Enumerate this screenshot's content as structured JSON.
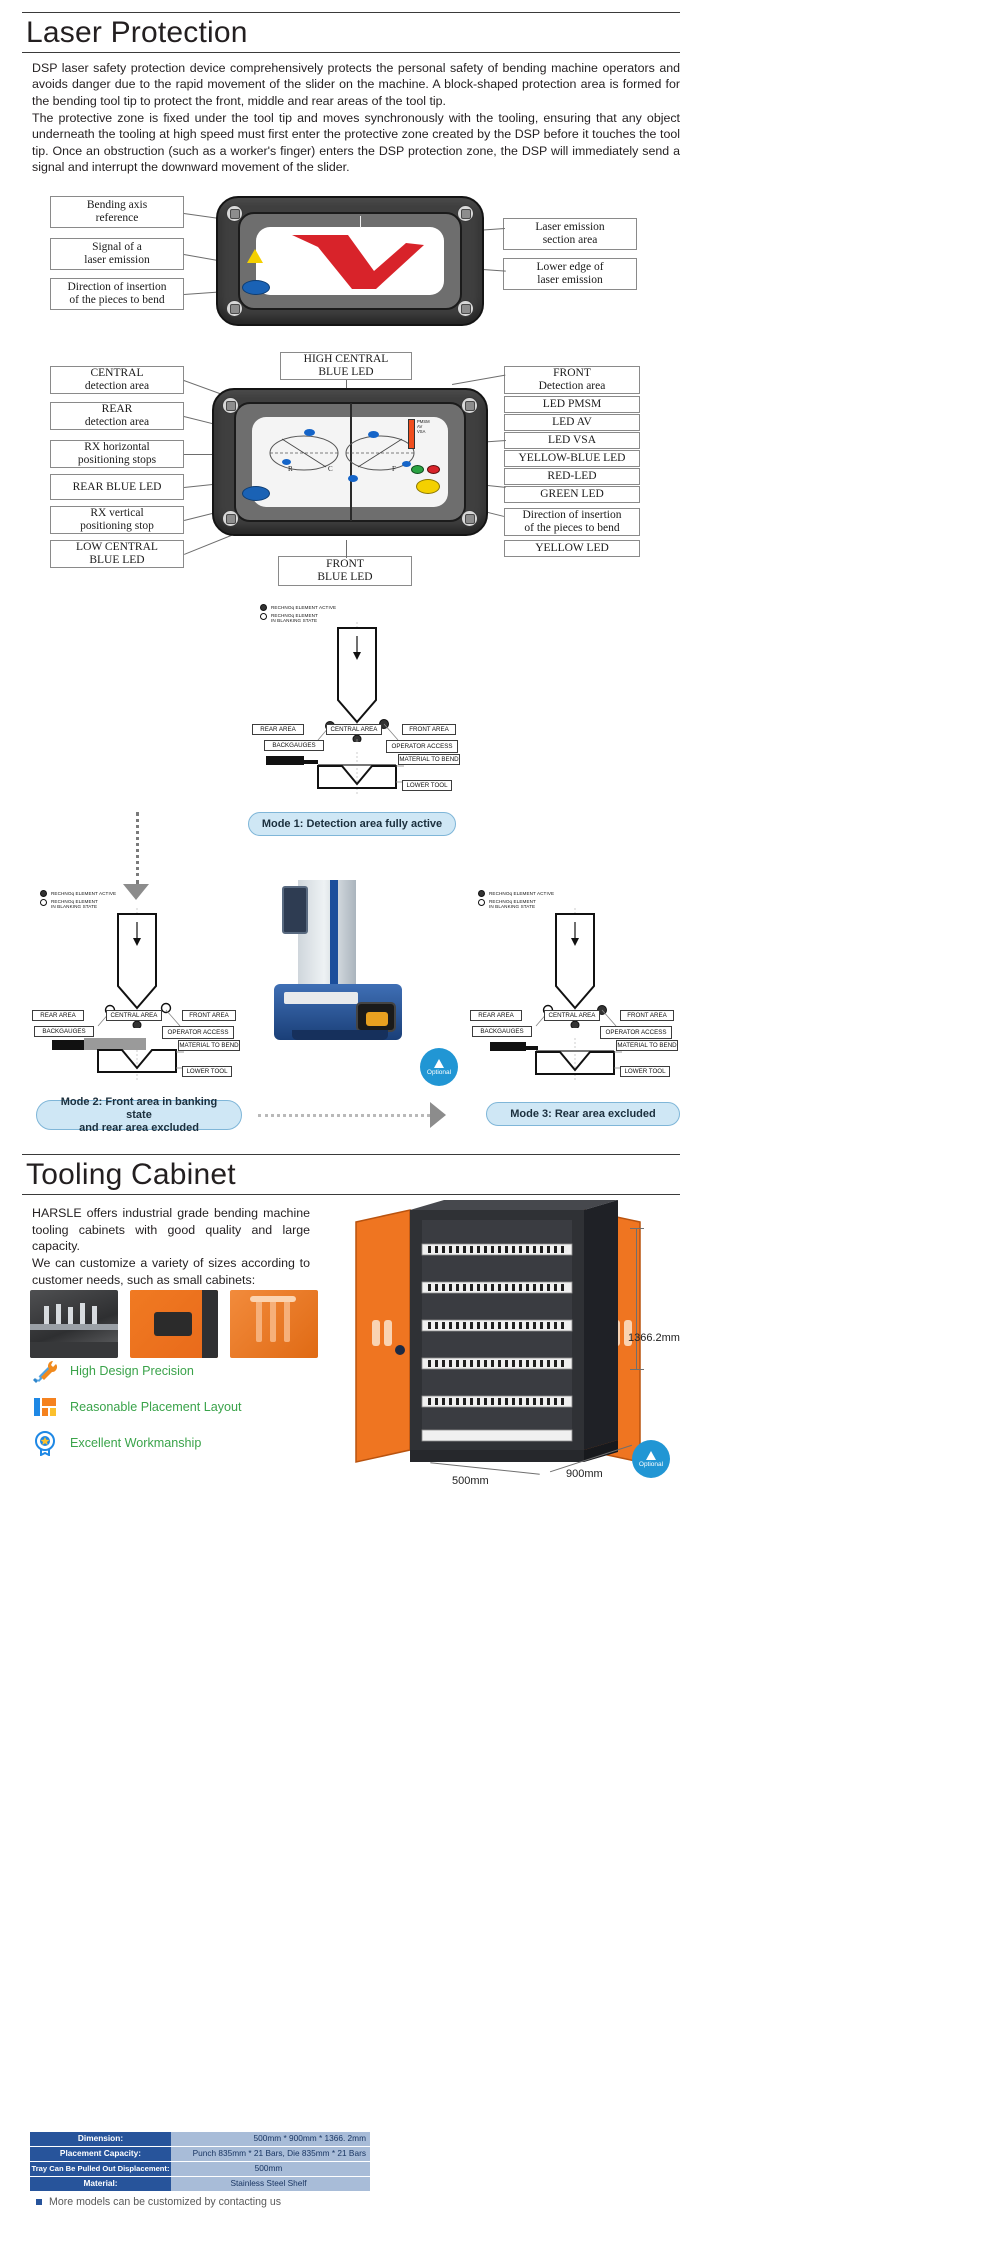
{
  "sections": {
    "laser": {
      "title": "Laser Protection",
      "paragraph1": "DSP laser safety protection device comprehensively protects the personal safety of bending machine operators and avoids danger due to the rapid movement of the slider on the machine. A block-shaped protection area is formed for the bending tool tip to protect the front, middle and rear areas of the tool tip.",
      "paragraph2": "The protective zone is fixed under the tool tip and moves synchronously with the tooling, ensuring that any object underneath the tooling at high speed must first enter the protective zone created by the DSP before it touches the tool tip. Once an obstruction (such as a worker's finger) enters the DSP protection zone, the DSP will immediately send a signal and interrupt the downward movement of the slider."
    },
    "cabinet": {
      "title": "Tooling Cabinet",
      "paragraph1": "HARSLE offers industrial grade bending machine tooling cabinets with good quality and large capacity.",
      "paragraph2": "We can customize a variety of sizes according to customer needs, such as small cabinets:"
    }
  },
  "diagram1": {
    "labels_left": [
      "Bending axis\nreference",
      "Signal of a\nlaser emission",
      "Direction of insertion\nof the pieces to bend"
    ],
    "labels_right": [
      "Laser emission\nsection area",
      "Lower edge of\nlaser emission"
    ]
  },
  "diagram2": {
    "label_top": "HIGH CENTRAL\nBLUE LED",
    "labels_left": [
      "CENTRAL\ndetection area",
      "REAR\ndetection area",
      "RX horizontal\npositioning stops",
      "REAR BLUE LED",
      "RX vertical\npositioning stop",
      "LOW CENTRAL\nBLUE LED"
    ],
    "labels_right": [
      "FRONT\nDetection area",
      "LED PMSM",
      "LED AV",
      "LED VSA",
      "YELLOW-BLUE LED",
      "RED-LED",
      "GREEN LED",
      "Direction of insertion\nof the pieces to bend",
      "YELLOW LED"
    ],
    "label_bottom": "FRONT\nBLUE LED",
    "panel_text": [
      "PMSM",
      "AV",
      "VSA"
    ],
    "axis_marks": [
      "R",
      "C",
      "F"
    ]
  },
  "modes": [
    {
      "id": "mode1",
      "caption": "Mode 1: Detection area fully active",
      "legend": [
        "RECHNOq ELEMENT ACTIVE",
        "RECHNOq ELEMENT\nIN BLANKING STATE"
      ],
      "zone_labels": [
        "REAR AREA",
        "CENTRAL AREA",
        "FRONT AREA"
      ],
      "backgauges": "BACKGAUGES",
      "operator_access": "OPERATOR ACCESS",
      "material": "MATERIAL TO BEND",
      "lower_tool": "LOWER TOOL"
    },
    {
      "id": "mode2",
      "caption": "Mode 2: Front area in banking state\nand rear area excluded",
      "legend": [
        "RECHNOq ELEMENT ACTIVE",
        "RECHNOq ELEMENT\nIN BLANKING STATE"
      ],
      "zone_labels": [
        "REAR AREA",
        "CENTRAL AREA",
        "FRONT AREA"
      ],
      "backgauges": "BACKGAUGES",
      "operator_access": "OPERATOR ACCESS",
      "material": "MATERIAL TO BEND",
      "lower_tool": "LOWER TOOL"
    },
    {
      "id": "mode3",
      "caption": "Mode 3: Rear area excluded",
      "legend": [
        "RECHNOq ELEMENT ACTIVE",
        "RECHNOq ELEMENT\nIN BLANKING STATE"
      ],
      "zone_labels": [
        "REAR AREA",
        "CENTRAL AREA",
        "FRONT AREA"
      ],
      "backgauges": "BACKGAUGES",
      "operator_access": "OPERATOR ACCESS",
      "material": "MATERIAL TO BEND",
      "lower_tool": "LOWER TOOL"
    }
  ],
  "optional_badge": {
    "label": "Optional"
  },
  "features": [
    {
      "icon": "tools-icon",
      "label": "High Design Precision"
    },
    {
      "icon": "layout-icon",
      "label": "Reasonable Placement Layout"
    },
    {
      "icon": "medal-icon",
      "label": "Excellent Workmanship"
    }
  ],
  "spec_table": {
    "rows": [
      {
        "key": "Dimension:",
        "value": "500mm * 900mm * 1366. 2mm"
      },
      {
        "key": "Placement Capacity:",
        "value": "Punch 835mm * 21 Bars, Die 835mm * 21 Bars"
      },
      {
        "key": "Tray Can Be Pulled Out Displacement:",
        "value": "500mm"
      },
      {
        "key": "Material:",
        "value": "Stainless Steel Shelf"
      }
    ],
    "footnote": "More models can be customized by contacting us"
  },
  "cabinet_dims": {
    "height": "1366.2mm",
    "width": "500mm",
    "depth": "900mm"
  },
  "colors": {
    "accent_blue": "#27549b",
    "value_blue": "#a8bcd8",
    "green_text": "#3aa34a",
    "pill_blue": "#cfe7f5",
    "orange": "#ef7521",
    "red": "#d8232a"
  }
}
